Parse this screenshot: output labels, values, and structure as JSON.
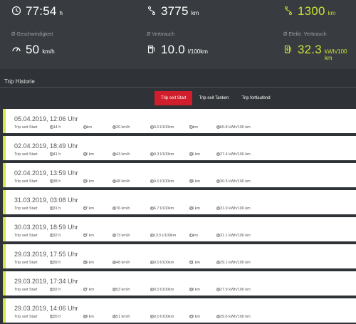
{
  "stats": {
    "duration": {
      "value": "77:54",
      "unit": "h",
      "icon": "clock-icon"
    },
    "distance": {
      "value": "3775",
      "unit": "km",
      "icon": "route-icon"
    },
    "electric_range": {
      "value": "1300",
      "unit": "km",
      "icon": "electric-route-icon"
    },
    "speed": {
      "label": "Ø Geschwindigkeit",
      "value": "50",
      "unit": "km/h",
      "icon": "speedometer-icon"
    },
    "consumption": {
      "label": "Ø Verbrauch",
      "value": "10.0",
      "unit": "l/100km",
      "icon": "fuel-pump-icon"
    },
    "electric_consumption": {
      "label": "Ø Elektr. Verbrauch",
      "value": "32.3",
      "unit": "kWh/100 km",
      "icon": "charging-station-icon"
    }
  },
  "section_title": "Trip Historie",
  "tabs": [
    {
      "label": "Trip seit Start",
      "active": true
    },
    {
      "label": "Trip seit Tanken",
      "active": false
    },
    {
      "label": "Trip fortlaufend",
      "active": false
    }
  ],
  "colors": {
    "accent_red": "#d11e2c",
    "accent_green": "#c8e03a",
    "trip_bar": "#d6e54b"
  },
  "trips": [
    {
      "date": "05.04.2019, 12:06 Uhr",
      "type": "Trip seit Start",
      "duration": "0:14 h",
      "distance": "4 km",
      "speed": "ø 20 km/h",
      "fuel": "ø 0.0 l/100km",
      "electric_distance": "5 km",
      "electric": "ø 60.8 kWh/100 km"
    },
    {
      "date": "02.04.2019, 18:49 Uhr",
      "type": "Trip seit Start",
      "duration": "0:41 h",
      "distance": "28 km",
      "speed": "ø 43 km/h",
      "fuel": "ø 0.3 l/100km",
      "electric_distance": "28 km",
      "electric": "ø 27.4 kWh/100 km"
    },
    {
      "date": "02.04.2019, 13:59 Uhr",
      "type": "Trip seit Start",
      "duration": "0:38 h",
      "distance": "29 km",
      "speed": "ø 48 km/h",
      "fuel": "ø 0.0 l/100km",
      "electric_distance": "30 km",
      "electric": "ø 30.5 kWh/100 km"
    },
    {
      "date": "31.03.2019, 03:08 Uhr",
      "type": "Trip seit Start",
      "duration": "0:31 h",
      "distance": "37 km",
      "speed": "ø 76 km/h",
      "fuel": "ø 6.7 l/100km",
      "electric_distance": "20 km",
      "electric": "ø 31.0 kWh/100 km"
    },
    {
      "date": "30.03.2019, 18:59 Uhr",
      "type": "Trip seit Start",
      "duration": "0:32 h",
      "distance": "37 km",
      "speed": "ø 73 km/h",
      "fuel": "ø 13.5 l/100km",
      "electric_distance": "1 km",
      "electric": "ø 31.1 kWh/100 km"
    },
    {
      "date": "29.03.2019, 17:55 Uhr",
      "type": "Trip seit Start",
      "duration": "0:39 h",
      "distance": "30 km",
      "speed": "ø 48 km/h",
      "fuel": "ø 0.0 l/100km",
      "electric_distance": "31 km",
      "electric": "ø 29.1 kWh/100 km"
    },
    {
      "date": "29.03.2019, 17:34 Uhr",
      "type": "Trip seit Start",
      "duration": "0:32 h",
      "distance": "27 km",
      "speed": "ø 53 km/h",
      "fuel": "ø 0.0 l/100km",
      "electric_distance": "28 km",
      "electric": "ø 27.9 kWh/100 km"
    },
    {
      "date": "29.03.2019, 14:06 Uhr",
      "type": "Trip seit Start",
      "duration": "0:35 h",
      "distance": "28 km",
      "speed": "ø 51 km/h",
      "fuel": "ø 0.0 l/100km",
      "electric_distance": "29 km",
      "electric": "ø 29.6 kWh/100 km"
    }
  ]
}
